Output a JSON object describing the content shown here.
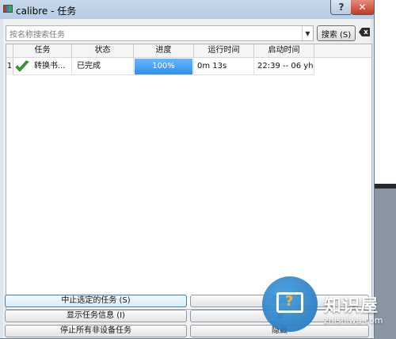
{
  "window": {
    "title": "calibre - 任务"
  },
  "titlebar": {
    "help_label": "?",
    "close_label": "✕"
  },
  "search": {
    "placeholder": "按名称搜索任务",
    "button_label": "搜索 (S)"
  },
  "table": {
    "columns": [
      "任务",
      "状态",
      "进度",
      "运行时间",
      "启动时间"
    ],
    "rows": [
      {
        "num": "1",
        "task": "转换书...",
        "status": "已完成",
        "progress": 100,
        "progress_text": "100%",
        "runtime": "0m 13s",
        "started": "22:39 -- 06 уh..."
      }
    ]
  },
  "buttons": {
    "stop_selected": "中止选定的任务 (S)",
    "show_info": "显示任务信息 (I)",
    "stop_all_nondevice": "停止所有非设备任务",
    "hide_1": "隐藏",
    "show_2": "显",
    "hide_3": "隐藏"
  },
  "watermark": {
    "title": "知识屋",
    "url": "zhishiwu.com",
    "accent": "#2a7fd0"
  }
}
